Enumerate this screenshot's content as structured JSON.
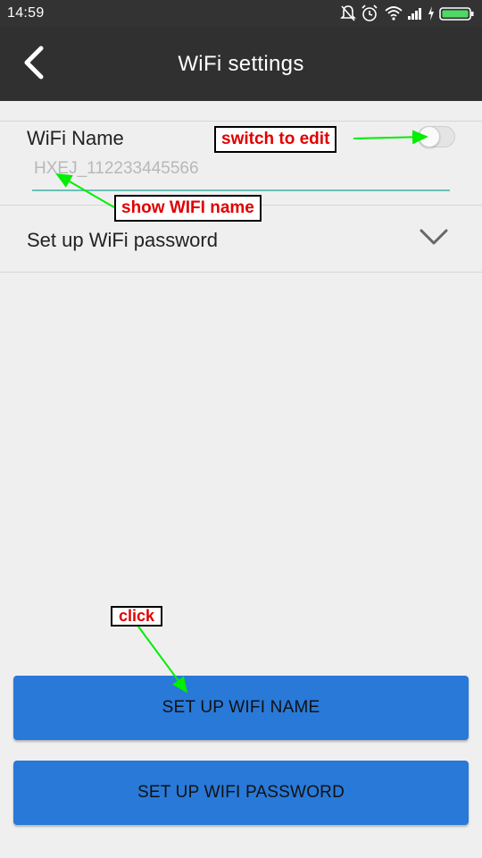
{
  "status_bar": {
    "time": "14:59",
    "icons": [
      "mute-icon",
      "alarm-icon",
      "wifi-icon",
      "signal-icon",
      "charging-icon",
      "battery-icon"
    ]
  },
  "app_bar": {
    "title": "WiFi settings",
    "back_icon": "back-chevron-icon"
  },
  "wifi_name_section": {
    "label": "WiFi Name",
    "toggle_on": false,
    "input_value": "HXEJ_112233445566"
  },
  "password_section": {
    "label": "Set up WiFi password",
    "expand_icon": "chevron-down-icon"
  },
  "buttons": {
    "set_name": "SET UP WIFI NAME",
    "set_password": "SET UP WIFI PASSWORD"
  },
  "annotations": {
    "switch_to_edit": "switch to edit",
    "show_wifi_name": "show WIFI name",
    "click": "click"
  },
  "colors": {
    "status_bar": "#333333",
    "app_bar": "#303030",
    "background": "#efefef",
    "button": "#2979d8",
    "input_underline": "#6cc0b6",
    "annotation_text": "#e00000",
    "arrow": "#00ee00",
    "battery": "#4cd964"
  }
}
